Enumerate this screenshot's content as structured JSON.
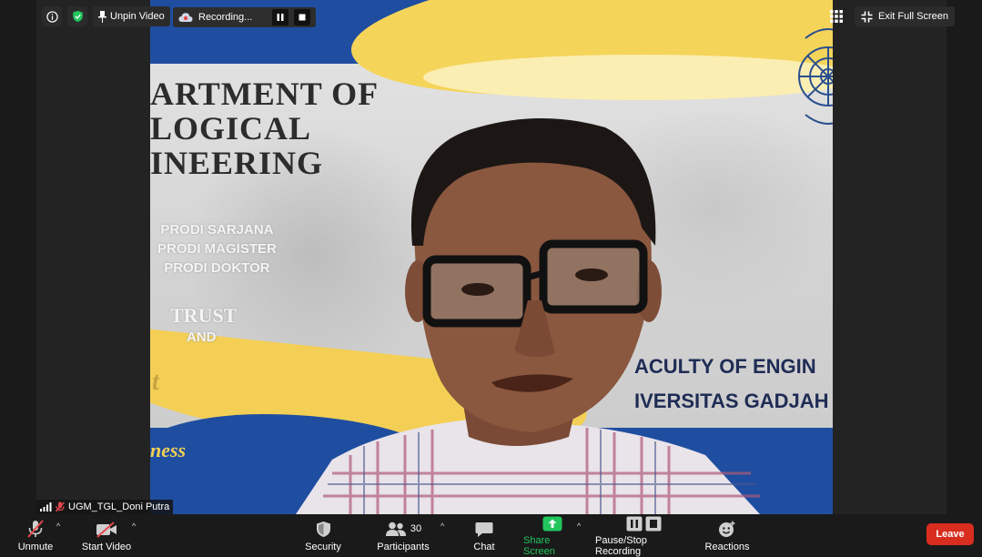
{
  "top_overlay": {
    "unpin_label": "Unpin Video",
    "recording_label": "Recording...",
    "exit_label": "Exit Full Screen"
  },
  "slide": {
    "department_lines": [
      "ARTMENT OF",
      "LOGICAL",
      "INEERING"
    ],
    "prodi_lines": [
      "PRODI SARJANA",
      "PRODI MAGISTER",
      "PRODI DOKTOR"
    ],
    "trust": "TRUST",
    "and": "AND",
    "script_top": "t",
    "script_bottom": "ness",
    "faculty_line1": "ACULTY OF ENGIN",
    "faculty_line2": "IVERSITAS GADJAH"
  },
  "participant": {
    "name": "UGM_TGL_Doni Putra"
  },
  "toolbar": {
    "unmute": "Unmute",
    "start_video": "Start Video",
    "security": "Security",
    "participants": "Participants",
    "participants_count": "30",
    "chat": "Chat",
    "share_screen": "Share Screen",
    "pause_stop": "Pause/Stop Recording",
    "reactions": "Reactions",
    "leave": "Leave"
  },
  "colors": {
    "accent_green": "#22c55e",
    "leave_red": "#d92d20",
    "slide_blue": "#1f4ea0",
    "slide_yellow": "#f5d45a"
  }
}
